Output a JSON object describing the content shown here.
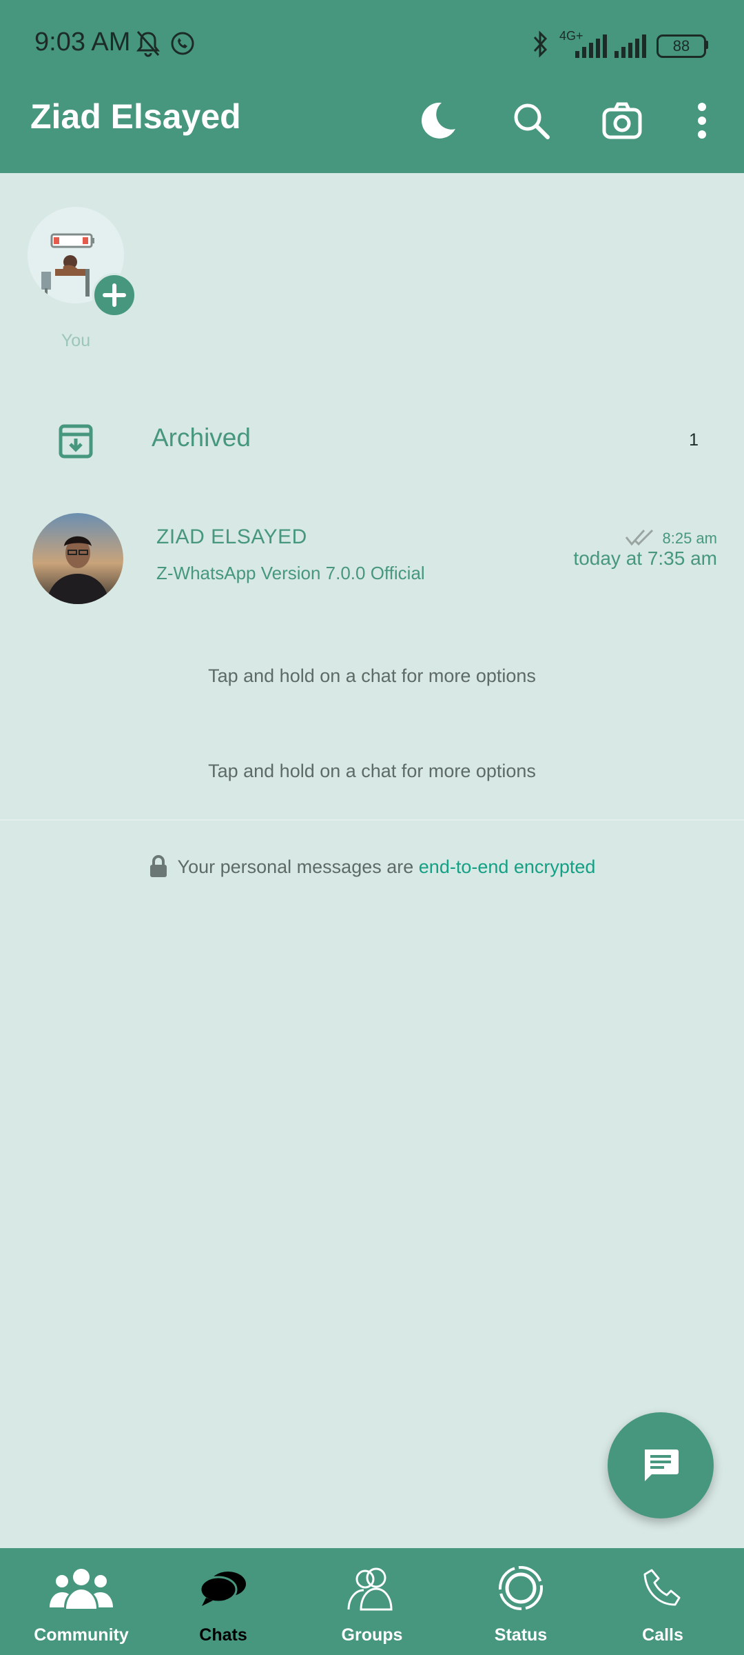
{
  "status_bar": {
    "time": "9:03 AM",
    "network": "4G+",
    "battery": "88"
  },
  "header": {
    "title": "Ziad Elsayed",
    "icons": [
      "moon-icon",
      "search-icon",
      "camera-icon",
      "more-options-icon"
    ]
  },
  "status": {
    "my_label": "You"
  },
  "archived": {
    "label": "Archived",
    "count": "1"
  },
  "chats": [
    {
      "name": "ZIAD ELSAYED",
      "preview": "Z-WhatsApp Version 7.0.0 Official",
      "time": "8:25 am",
      "last_seen": "today at 7:35 am"
    }
  ],
  "hints": [
    "Tap and hold on a chat for more options",
    "Tap and hold on a chat for more options"
  ],
  "encryption": {
    "text": "Your personal messages are",
    "link": "end-to-end encrypted"
  },
  "bottom_nav": {
    "items": [
      {
        "label": "Community",
        "icon": "community-icon"
      },
      {
        "label": "Chats",
        "icon": "chats-icon",
        "active": true
      },
      {
        "label": "Groups",
        "icon": "groups-icon"
      },
      {
        "label": "Status",
        "icon": "status-icon"
      },
      {
        "label": "Calls",
        "icon": "calls-icon"
      }
    ]
  },
  "colors": {
    "primary": "#46977e",
    "background": "#d8e8e4",
    "link": "#14a085"
  }
}
